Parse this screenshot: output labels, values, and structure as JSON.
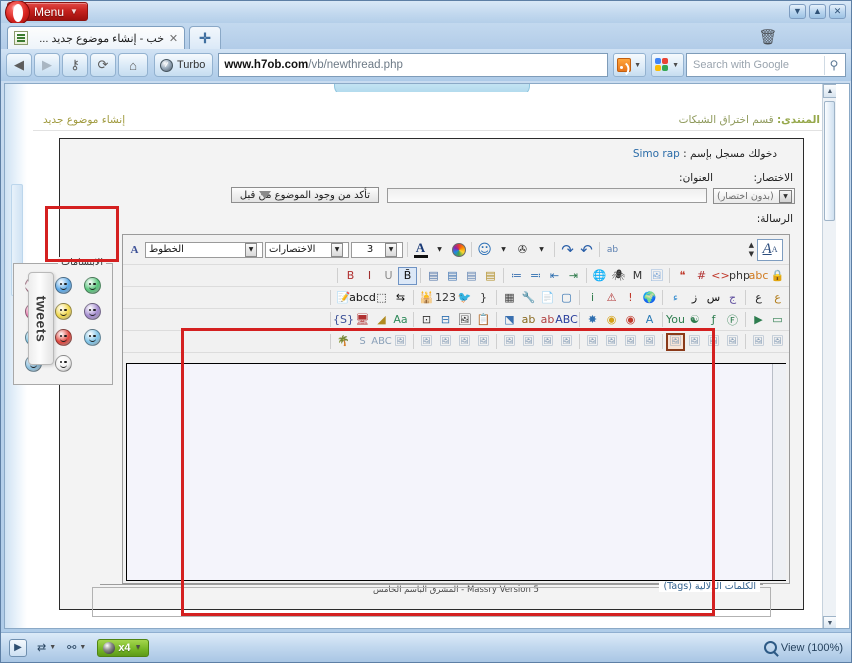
{
  "browser": {
    "menu_label": "Menu",
    "menu_caret": "▼",
    "window_controls": [
      {
        "name": "minimize",
        "glyph": "▼"
      },
      {
        "name": "maximize",
        "glyph": "▲"
      },
      {
        "name": "close",
        "glyph": "✕"
      }
    ],
    "trash_icon": "🗑",
    "tab": {
      "title": "خب - إنشاء موضوع جديد ...",
      "close_glyph": "✕"
    },
    "new_tab_glyph": "✛",
    "nav": {
      "back": "◀",
      "forward": "▶",
      "wand": "⚷",
      "reload": "⟳",
      "home": "⌂",
      "turbo_label": "Turbo"
    },
    "address": {
      "host": "www.h7ob.com",
      "path": "/vb/newthread.php"
    },
    "rss_caret": "▼",
    "google_caret": "▼",
    "search": {
      "placeholder": "Search with Google",
      "value": "",
      "go_glyph": "⚲"
    }
  },
  "sidebar": {
    "tweets_label": "tweets"
  },
  "forum": {
    "breadcrumb_prefix": "المنتدى:",
    "breadcrumb_section": "قسم اختراق الشبكات",
    "page_title": "إنشاء موضوع جديد",
    "logged_in_prefix": "دخولك مسجل بإسم :",
    "logged_in_user": "Simo rap",
    "labels": {
      "abbreviation": "الاختصار:",
      "title": "العنوان:",
      "message": "الرسالة:",
      "tags": "الكلمات الدلالية (Tags)"
    },
    "abbreviation_value": "(بدون اختصار)",
    "title_value": "",
    "check_button": "تأكد من وجود الموضوع من قبل",
    "dropdown_arrow": "▼",
    "version_line": "المشرق الباسم الخامس - Massry Version 5"
  },
  "editor": {
    "toggle": {
      "aa_small": "A",
      "aa_big": "A",
      "up_glyph": "▲",
      "down_glyph": "▼"
    },
    "row1": {
      "spellcheck": "ab",
      "undo": "↶",
      "redo": "↷",
      "attach_caret": "▼",
      "attach": "✇",
      "smiley_caret": "▼",
      "smiley": "☺",
      "color_caret": "▼",
      "fontcolor": "A",
      "size_caret": "▼",
      "size_value": "3",
      "sizes_caret": "▼",
      "sizes_label": "الاختصارات",
      "fonts_caret": "▼",
      "fonts_label": "الخطوط",
      "wysiwyg": "A"
    },
    "row2": [
      "🔒",
      "abc",
      "php",
      "<>",
      "#",
      "❝",
      "🖼",
      "M",
      "🕷",
      "🌐",
      "⇥",
      "⇤",
      "≔",
      "≕",
      "▤",
      "▤",
      "▤",
      "▤",
      "B̄",
      "U",
      "I",
      "B"
    ],
    "row3": [
      "ع",
      "ع",
      "ج",
      "س",
      "ز",
      "ء",
      "🌍",
      "!",
      "⚠",
      "i",
      "▢",
      "📄",
      "🔧",
      "▦",
      "{",
      "🐦",
      "123",
      "🕌",
      "⇆",
      "⬚",
      "abcd",
      "📝"
    ],
    "row4": [
      "▭",
      "▶",
      "Ⓕ",
      "ƒ",
      "☯",
      "You",
      "A",
      "◉",
      "◉",
      "✸",
      "ABC",
      "ab",
      "ab",
      "⬔",
      "📋",
      "🖼",
      "⊟",
      "⊡",
      "Aa",
      "◢",
      "🖥",
      "{S}"
    ],
    "row5": [
      "🖼",
      "🖼",
      "🖼",
      "🖼",
      "🖼",
      "🖼",
      "🖼",
      "🖼",
      "🖼",
      "🖼",
      "🖼",
      "🖼",
      "🖼",
      "🖼",
      "🖼",
      "🖼",
      "🖼",
      "🖼",
      "🖼",
      "ABC",
      "S",
      "🌴"
    ],
    "smilies": {
      "legend": "الابتسامات",
      "items": [
        {
          "name": "cool-green",
          "color": "#57c47a"
        },
        {
          "name": "smile-blue",
          "color": "#5aa8e8"
        },
        {
          "name": "laugh-pink",
          "color": "#f2a9c6"
        },
        {
          "name": "sad-purple",
          "color": "#a48bd0"
        },
        {
          "name": "smile-yellow",
          "color": "#f2d84a"
        },
        {
          "name": "blush-pink",
          "color": "#ec86b6"
        },
        {
          "name": "sleepy-blue",
          "color": "#7fc4e8"
        },
        {
          "name": "angry-red",
          "color": "#e0453c"
        },
        {
          "name": "confused-blue",
          "color": "#89cbe8",
          "badge": "???"
        },
        {
          "name": "empty",
          "color": ""
        },
        {
          "name": "shock-white",
          "color": "#f2f2f2"
        },
        {
          "name": "sunglasses-blue",
          "color": "#8fc3e2"
        }
      ]
    }
  },
  "statusbar": {
    "panel_glyph": "▶",
    "items": [
      {
        "name": "transfers",
        "glyph": "⇄",
        "caret": "▼"
      },
      {
        "name": "cookies",
        "glyph": "⚯",
        "caret": "▼"
      }
    ],
    "blocked_count": "x4",
    "view_label": "View (100%)"
  }
}
